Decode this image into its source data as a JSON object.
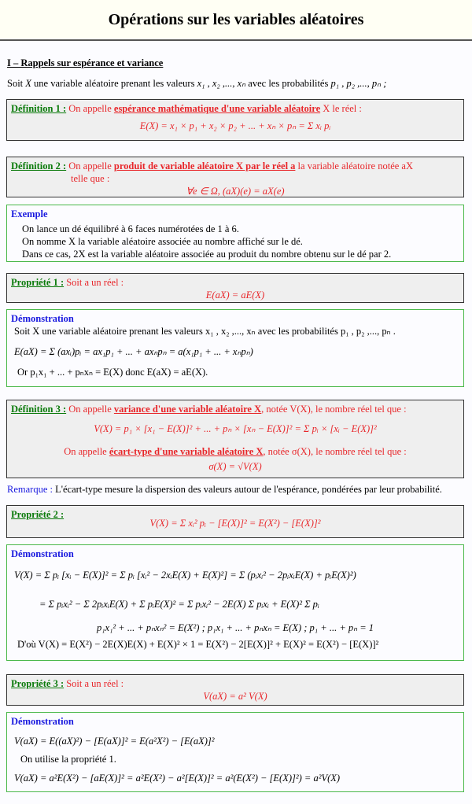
{
  "title": "Opérations sur les variables aléatoires",
  "section1": {
    "title": "I – Rappels sur espérance et variance",
    "intro_prefix": "Soit",
    "intro_var": "X",
    "intro_mid": "une variable aléatoire prenant les valeurs",
    "intro_values": "x₁ , x₂ ,..., xₙ",
    "intro_mid2": "avec les probabilités",
    "intro_probs": "p₁ , p₂ ,..., pₙ ;"
  },
  "def1": {
    "label": "Définition 1 :",
    "text_before": "On appelle",
    "term": "espérance mathématique d'une variable aléatoire",
    "text_after": "X le réel :",
    "formula": "E(X) = x₁ × p₁ + x₂ × p₂ + ... + xₙ × pₙ = Σ xᵢ pᵢ"
  },
  "def2": {
    "label": "Définition 2 :",
    "text_before": "On appelle",
    "term": "produit de variable aléatoire X par le réel a",
    "text_after": "la variable aléatoire notée aX",
    "text_line2": "telle que :",
    "formula": "∀e ∈ Ω, (aX)(e) = aX(e)"
  },
  "example": {
    "label": "Exemple",
    "lines": [
      "On lance un dé équilibré à 6 faces numérotées de 1 à 6.",
      "On nomme X la variable aléatoire associée au nombre affiché sur le dé.",
      "Dans ce cas, 2X est la variable aléatoire associée au produit du nombre obtenu sur le dé par 2."
    ]
  },
  "prop1": {
    "label": "Propriété 1 :",
    "text": "Soit a un réel :",
    "formula": "E(aX) = aE(X)"
  },
  "demo1": {
    "label": "Démonstration",
    "line1": "Soit X une variable aléatoire prenant les valeurs x₁ , x₂ ,..., xₙ avec les probabilités p₁ , p₂ ,..., pₙ .",
    "line2": "E(aX) = Σ (axᵢ)pᵢ = ax₁p₁ + ... + axₙpₙ = a(x₁p₁ + ... + xₙpₙ)",
    "line3": "Or p₁x₁ + ... + pₙxₙ = E(X)  donc  E(aX) = aE(X)."
  },
  "def3": {
    "label": "Définition 3 :",
    "text_before": "On appelle",
    "term": "variance d'une variable aléatoire X",
    "text_after": ", notée V(X), le nombre réel tel que :",
    "formula1": "V(X) = p₁ × [x₁ − E(X)]² + ... + pₙ × [xₙ − E(X)]² = Σ pᵢ × [xᵢ − E(X)]²",
    "text2_before": "On appelle",
    "term2": "écart-type d'une variable aléatoire X",
    "text2_after": ", notée σ(X), le nombre réel tel que :",
    "formula2": "σ(X) = √V(X)"
  },
  "remark": {
    "label": "Remarque :",
    "text": "L'écart-type mesure la dispersion des valeurs autour de l'espérance, pondérées par leur probabilité."
  },
  "prop2": {
    "label": "Propriété 2 :",
    "formula": "V(X) = Σ xᵢ² pᵢ − [E(X)]² = E(X²) − [E(X)]²"
  },
  "demo2": {
    "label": "Démonstration",
    "line1": "V(X) = Σ pᵢ [xᵢ − E(X)]² = Σ pᵢ [xᵢ² − 2xᵢE(X) + E(X)²] = Σ (pᵢxᵢ² − 2pᵢxᵢE(X) + pᵢE(X)²)",
    "line2": "= Σ pᵢxᵢ² − Σ 2pᵢxᵢE(X) + Σ pᵢE(X)² = Σ pᵢxᵢ² − 2E(X) Σ pᵢxᵢ + E(X)² Σ pᵢ",
    "line3": "p₁x₁² + ... + pₙxₙ² = E(X²) ;  p₁x₁ + ... + pₙxₙ = E(X) ;  p₁ + ... + pₙ = 1",
    "line4": "D'où  V(X) = E(X²) − 2E(X)E(X) + E(X)² × 1 = E(X²) − 2[E(X)]² + E(X)² = E(X²) − [E(X)]²"
  },
  "prop3": {
    "label": "Propriété 3 :",
    "text": "Soit a un réel :",
    "formula": "V(aX) = a² V(X)"
  },
  "demo3": {
    "label": "Démonstration",
    "line1": "V(aX) = E((aX)²) − [E(aX)]² = E(a²X²) − [E(aX)]²",
    "line2": "On utilise la propriété 1.",
    "line3": "V(aX) = a²E(X²) − [aE(X)]² = a²E(X²) − a²[E(X)]² = a²(E(X²) − [E(X)]²) = a²V(X)"
  },
  "colors": {
    "label_green": "#0a7a0a",
    "label_blue": "#1a1adf",
    "text_red": "#e8262a",
    "box_gray_bg": "#efefef",
    "box_green_border": "#4ab84a",
    "header_bg": "#fffff4"
  }
}
